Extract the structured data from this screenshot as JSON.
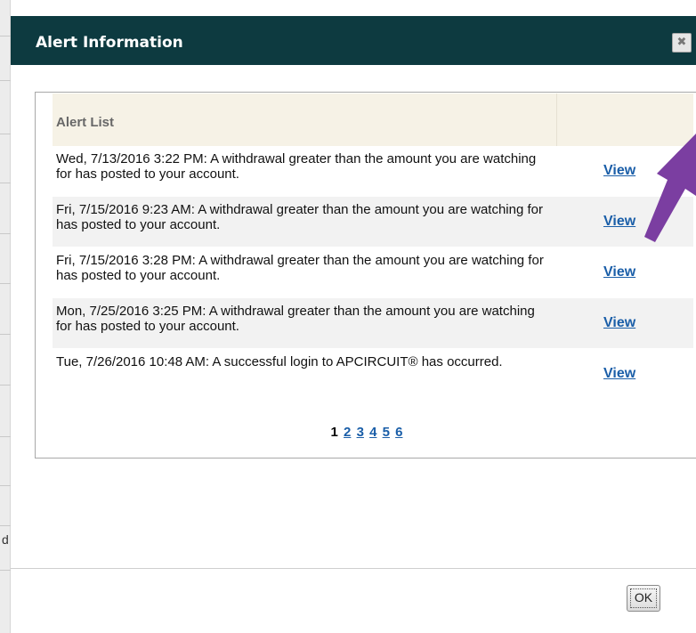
{
  "dialog": {
    "title": "Alert Information",
    "close_glyph": "✖",
    "close_icon": "close-icon"
  },
  "alert_list": {
    "header": "Alert List",
    "rows": [
      {
        "message": "Wed, 7/13/2016 3:22 PM: A withdrawal greater than the amount you are watching for has posted to your account.",
        "action": "View"
      },
      {
        "message": "Fri, 7/15/2016 9:23 AM: A withdrawal greater than the amount you are watching for has posted to your account.",
        "action": "View"
      },
      {
        "message": "Fri, 7/15/2016 3:28 PM: A withdrawal greater than the amount you are watching for has posted to your account.",
        "action": "View"
      },
      {
        "message": "Mon, 7/25/2016 3:25 PM: A withdrawal greater than the amount you are watching for has posted to your account.",
        "action": "View"
      },
      {
        "message": "Tue, 7/26/2016 10:48 AM: A successful login to APCIRCUIT® has occurred.",
        "action": "View"
      }
    ]
  },
  "pagination": {
    "current": "1",
    "pages": [
      "2",
      "3",
      "4",
      "5",
      "6"
    ]
  },
  "footer": {
    "ok_label": "OK"
  },
  "background": {
    "glyph": "d"
  },
  "colors": {
    "titlebar": "#0d3a40",
    "link": "#1a5ea8",
    "header_bg": "#f6f2e6",
    "annotation_arrow": "#7b3ea1"
  }
}
